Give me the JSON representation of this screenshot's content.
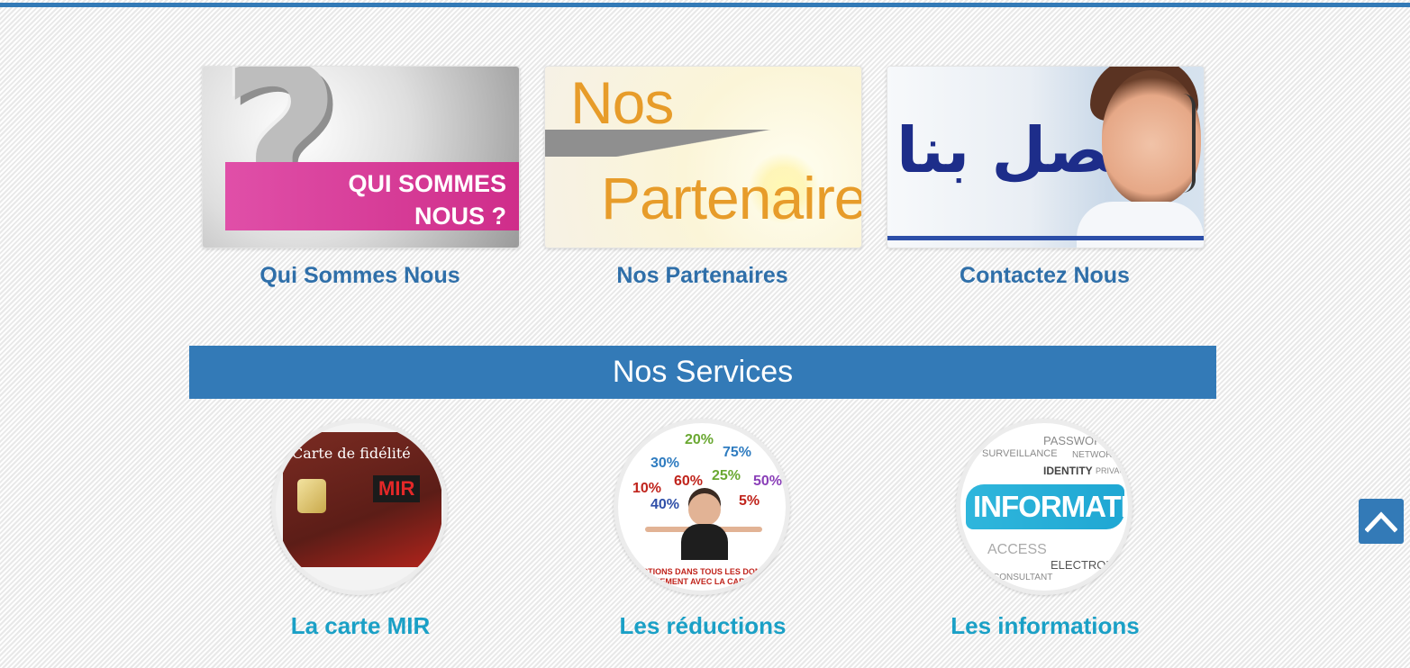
{
  "tiles": [
    {
      "caption": "Qui Sommes Nous",
      "banner_line1": "QUI SOMMES",
      "banner_line2": "NOUS ?"
    },
    {
      "caption": "Nos Partenaires",
      "word1": "Nos",
      "word2": "Partenaires"
    },
    {
      "caption": "Contactez Nous",
      "arabic_text": "أتصل بنا"
    }
  ],
  "services": {
    "heading": "Nos Services",
    "items": [
      {
        "label": "La carte MIR",
        "card_title": "Carte de fidélité",
        "card_brand": "MIR"
      },
      {
        "label": "Les réductions",
        "percentages": [
          "20%",
          "75%",
          "30%",
          "60%",
          "25%",
          "50%",
          "10%",
          "40%",
          "5%"
        ],
        "banner_line1": "UCTIONS DANS TOUS LES DOMA",
        "banner_line2": "UEMENT AVEC LA CART"
      },
      {
        "label": "Les informations",
        "center_word": "INFORMATION",
        "cloud_words": [
          "PASSWORD",
          "SURVEILLANCE",
          "NETWORK",
          "IDENTITY",
          "PRIVACY",
          "ACCESS",
          "ELECTRON",
          "CONSULTANT"
        ]
      }
    ]
  },
  "scroll_top": {
    "icon": "chevron-up-icon"
  },
  "colors": {
    "accent": "#337ab7",
    "service_caption": "#1aa0c6",
    "tile_caption": "#2f6fa9"
  }
}
